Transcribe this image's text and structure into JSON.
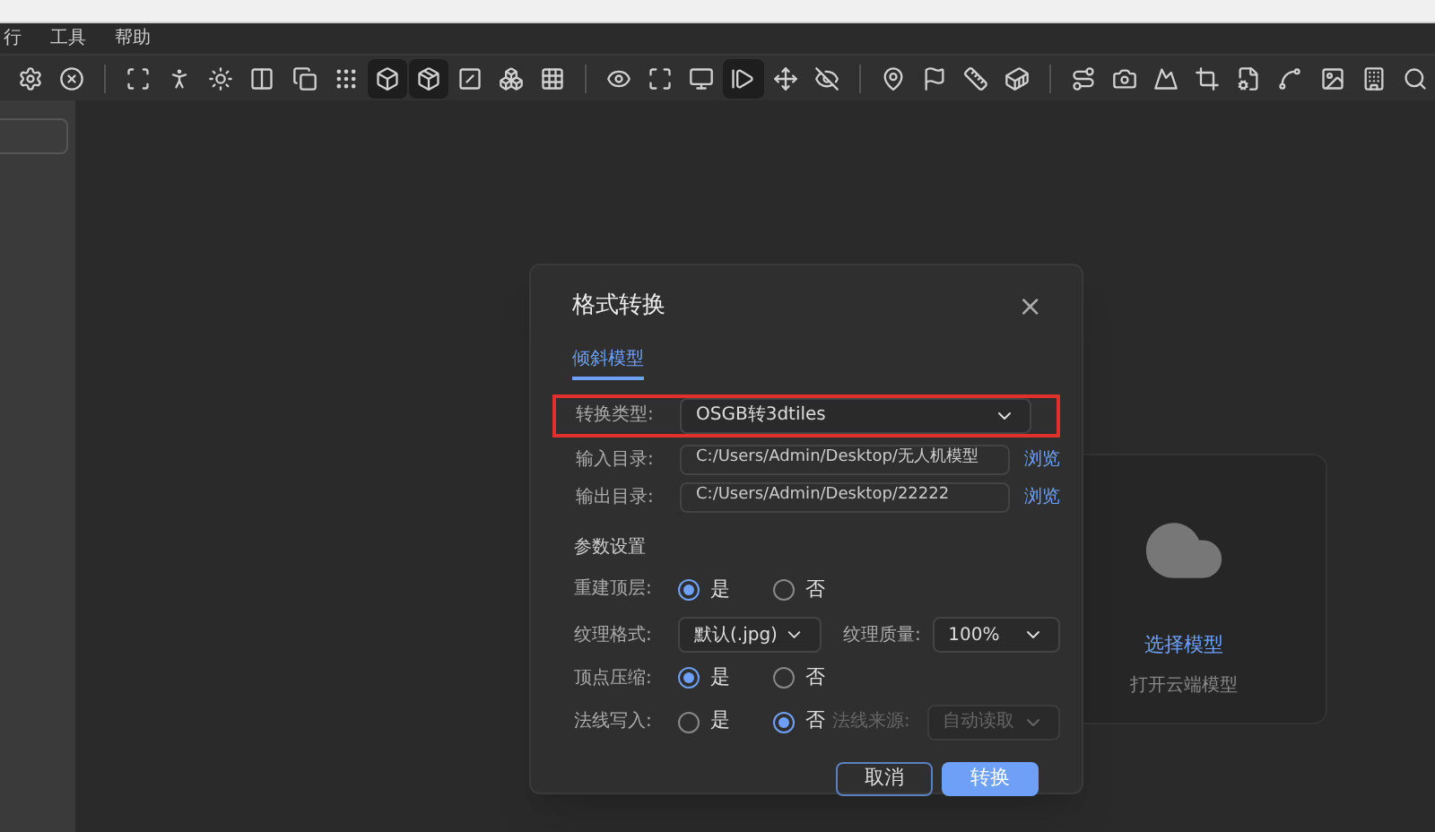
{
  "menu": [
    {
      "label": "行"
    },
    {
      "label": "工具"
    },
    {
      "label": "帮助"
    }
  ],
  "toolbar": {
    "groups": [
      [
        {
          "selected": false
        },
        {
          "selected": false
        }
      ],
      [
        {
          "selected": false
        },
        {
          "selected": false
        },
        {
          "selected": false
        },
        {
          "selected": false
        },
        {
          "selected": false
        },
        {
          "selected": false
        },
        {
          "selected": true
        },
        {
          "selected": true
        },
        {
          "selected": false
        },
        {
          "selected": false
        },
        {
          "selected": false
        }
      ],
      [
        {
          "selected": false
        },
        {
          "selected": false
        },
        {
          "selected": false
        },
        {
          "selected": true
        },
        {
          "selected": false
        },
        {
          "selected": false
        }
      ],
      [
        {
          "selected": false
        },
        {
          "selected": false
        },
        {
          "selected": false
        },
        {
          "selected": false
        }
      ],
      [
        {
          "selected": false
        },
        {
          "selected": false
        },
        {
          "selected": false
        },
        {
          "selected": false
        },
        {
          "selected": false
        },
        {
          "selected": false
        },
        {
          "selected": false
        },
        {
          "selected": false
        },
        {
          "selected": false
        }
      ]
    ]
  },
  "card": {
    "action": "选择模型",
    "hint": "打开云端模型"
  },
  "dialog": {
    "title": "格式转换",
    "close": "×",
    "tabs": [
      {
        "label": "倾斜模型",
        "selected": true
      }
    ],
    "conversion": {
      "label": "转换类型:",
      "value": "OSGB转3dtiles",
      "highlighted": true
    },
    "paths": [
      {
        "label": "输入目录:",
        "value": "C:/Users/Admin/Desktop/无人机模型",
        "browse": "浏览"
      },
      {
        "label": "输出目录:",
        "value": "C:/Users/Admin/Desktop/22222",
        "browse": "浏览"
      }
    ],
    "section": "参数设置",
    "rebuild": {
      "label": "重建顶层:",
      "options": [
        {
          "label": "是",
          "selected": true
        },
        {
          "label": "否",
          "selected": false
        }
      ]
    },
    "texture": {
      "label": "纹理格式:",
      "value": "默认(.jpg)",
      "quality_label": "纹理质量:",
      "quality": "100%"
    },
    "compress": {
      "label": "顶点压缩:",
      "options": [
        {
          "label": "是",
          "selected": true
        },
        {
          "label": "否",
          "selected": false
        }
      ]
    },
    "normals": {
      "label": "法线写入:",
      "options": [
        {
          "label": "是",
          "selected": false
        },
        {
          "label": "否",
          "selected": true
        }
      ],
      "source_label": "法线来源:",
      "source": "自动读取",
      "source_disabled": true
    },
    "buttons": [
      {
        "label": "取消",
        "kind": "secondary"
      },
      {
        "label": "转换",
        "kind": "primary"
      }
    ]
  }
}
